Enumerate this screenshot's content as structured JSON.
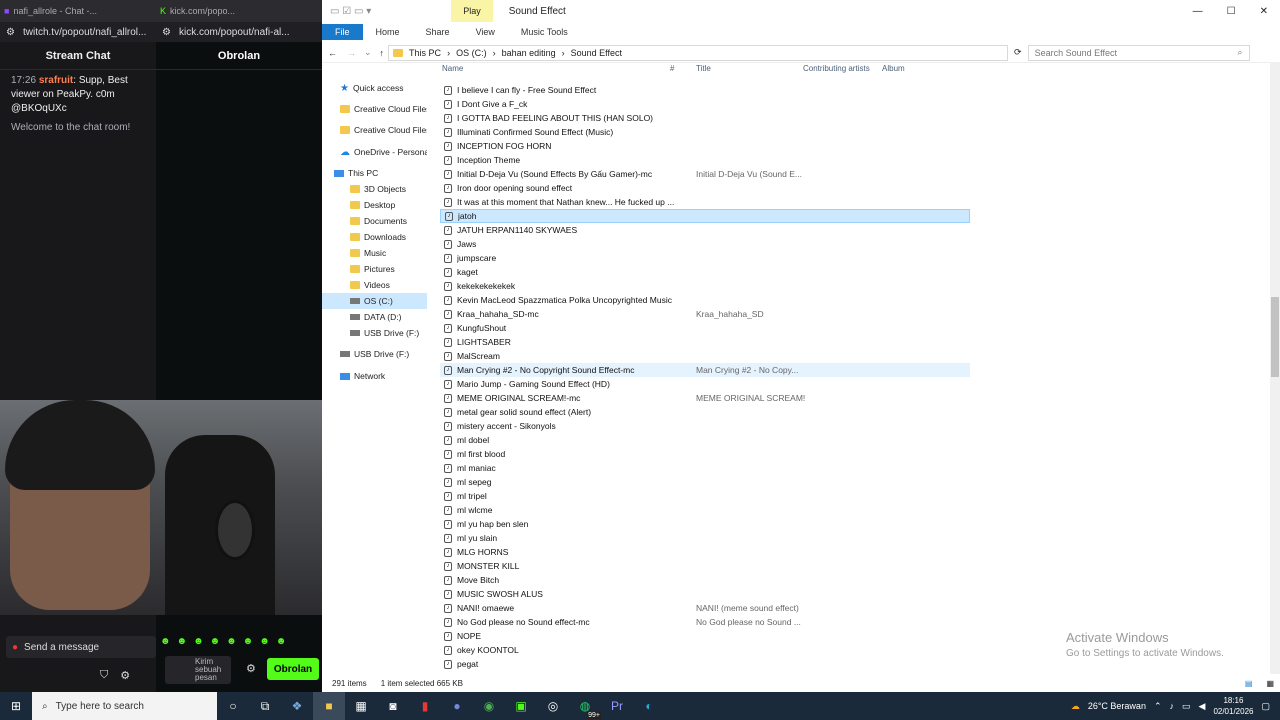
{
  "twitch": {
    "tab_title": "nafi_allrole - Chat -...",
    "url": "twitch.tv/popout/nafi_allrol...",
    "chat_title": "Stream Chat",
    "message": {
      "time": "17:26",
      "user": "srafruit",
      "text": "Supp, Best viewer on PeakPy. c0m",
      "mention": "@BKOqUXc"
    },
    "welcome": "Welcome to the chat room!",
    "input_placeholder": "Send a message"
  },
  "kick": {
    "tab_title": "kick.com/popo...",
    "url": "kick.com/popout/nafi-al...",
    "chat_title": "Obrolan",
    "input_placeholder": "Kirim sebuah pesan",
    "send_label": "Obrolan"
  },
  "explorer": {
    "title": "Sound Effect",
    "play_tab": "Play",
    "tabs": [
      "File",
      "Home",
      "Share",
      "View",
      "Music Tools"
    ],
    "breadcrumb": [
      "This PC",
      "OS (C:)",
      "bahan editing",
      "Sound Effect"
    ],
    "search_placeholder": "Search Sound Effect",
    "columns": {
      "name": "Name",
      "num": "#",
      "title": "Title",
      "artists": "Contributing artists",
      "album": "Album"
    },
    "nav": [
      {
        "label": "Quick access",
        "icon": "star-icon"
      },
      {
        "label": "Creative Cloud Files",
        "icon": "folder-icon"
      },
      {
        "label": "Creative Cloud Files P",
        "icon": "folder-icon"
      },
      {
        "label": "OneDrive - Personal",
        "icon": "cloud-icon"
      },
      {
        "label": "This PC",
        "icon": "pc-icon"
      },
      {
        "label": "3D Objects",
        "icon": "folder-icon"
      },
      {
        "label": "Desktop",
        "icon": "folder-icon"
      },
      {
        "label": "Documents",
        "icon": "folder-icon"
      },
      {
        "label": "Downloads",
        "icon": "folder-icon"
      },
      {
        "label": "Music",
        "icon": "folder-icon"
      },
      {
        "label": "Pictures",
        "icon": "folder-icon"
      },
      {
        "label": "Videos",
        "icon": "folder-icon"
      },
      {
        "label": "OS (C:)",
        "icon": "drive-icon"
      },
      {
        "label": "DATA (D:)",
        "icon": "drive-icon"
      },
      {
        "label": "USB Drive (F:)",
        "icon": "drive-icon"
      },
      {
        "label": "USB Drive (F:)",
        "icon": "drive-icon"
      },
      {
        "label": "Network",
        "icon": "network-icon"
      }
    ],
    "files": [
      {
        "name": "I believe I can fly - Free Sound Effect",
        "title": ""
      },
      {
        "name": "I Dont Give a F_ck",
        "title": ""
      },
      {
        "name": "I GOTTA BAD FEELING ABOUT THIS (HAN SOLO)",
        "title": ""
      },
      {
        "name": "Illuminati Confirmed Sound Effect (Music)",
        "title": ""
      },
      {
        "name": "INCEPTION FOG HORN",
        "title": ""
      },
      {
        "name": "Inception Theme",
        "title": ""
      },
      {
        "name": "Initial D-Deja Vu (Sound Effects By Gấu Gamer)-mc",
        "title": "Initial D-Deja Vu (Sound E..."
      },
      {
        "name": "Iron door opening sound effect",
        "title": ""
      },
      {
        "name": "It was at this moment that Nathan knew... He fucked up ...",
        "title": ""
      },
      {
        "name": "jatoh",
        "title": ""
      },
      {
        "name": "JATUH ERPAN1140 SKYWAES",
        "title": ""
      },
      {
        "name": "Jaws",
        "title": ""
      },
      {
        "name": "jumpscare",
        "title": ""
      },
      {
        "name": "kaget",
        "title": ""
      },
      {
        "name": "kekekekekekek",
        "title": ""
      },
      {
        "name": "Kevin MacLeod  Spazzmatica Polka  Uncopyrighted Music",
        "title": ""
      },
      {
        "name": "Kraa_hahaha_SD-mc",
        "title": "Kraa_hahaha_SD"
      },
      {
        "name": "KungfuShout",
        "title": ""
      },
      {
        "name": "LIGHTSABER",
        "title": ""
      },
      {
        "name": "MalScream",
        "title": ""
      },
      {
        "name": "Man Crying #2 - No Copyright Sound Effect-mc",
        "title": "Man Crying #2 - No Copy..."
      },
      {
        "name": "Mario Jump - Gaming Sound Effect (HD)",
        "title": ""
      },
      {
        "name": "MEME ORIGINAL SCREAM!-mc",
        "title": "MEME ORIGINAL SCREAM!"
      },
      {
        "name": "metal gear solid sound effect (Alert)",
        "title": ""
      },
      {
        "name": "mistery accent - Sikonyols",
        "title": ""
      },
      {
        "name": "ml dobel",
        "title": ""
      },
      {
        "name": "ml first blood",
        "title": ""
      },
      {
        "name": "ml maniac",
        "title": ""
      },
      {
        "name": "ml sepeg",
        "title": ""
      },
      {
        "name": "ml tripel",
        "title": ""
      },
      {
        "name": "ml wlcme",
        "title": ""
      },
      {
        "name": "ml yu hap ben slen",
        "title": ""
      },
      {
        "name": "ml yu slain",
        "title": ""
      },
      {
        "name": "MLG HORNS",
        "title": ""
      },
      {
        "name": "MONSTER KILL",
        "title": ""
      },
      {
        "name": "Move Bitch",
        "title": ""
      },
      {
        "name": "MUSIC SWOSH ALUS",
        "title": ""
      },
      {
        "name": "NANI! omaewe",
        "title": "NANI! (meme sound effect)"
      },
      {
        "name": "No God please no Sound effect-mc",
        "title": "No God please no Sound ..."
      },
      {
        "name": "NOPE",
        "title": ""
      },
      {
        "name": "okey KOONTOL",
        "title": ""
      },
      {
        "name": "pegat",
        "title": ""
      }
    ],
    "selected_index": 9,
    "hover_index": 20,
    "status_items": "291 items",
    "status_selected": "1 item selected  665 KB",
    "watermark_title": "Activate Windows",
    "watermark_sub": "Go to Settings to activate Windows."
  },
  "taskbar": {
    "search_placeholder": "Type here to search",
    "weather": "26°C  Berawan",
    "time": "18:16",
    "date": "02/01/2026",
    "badge": "99+"
  }
}
